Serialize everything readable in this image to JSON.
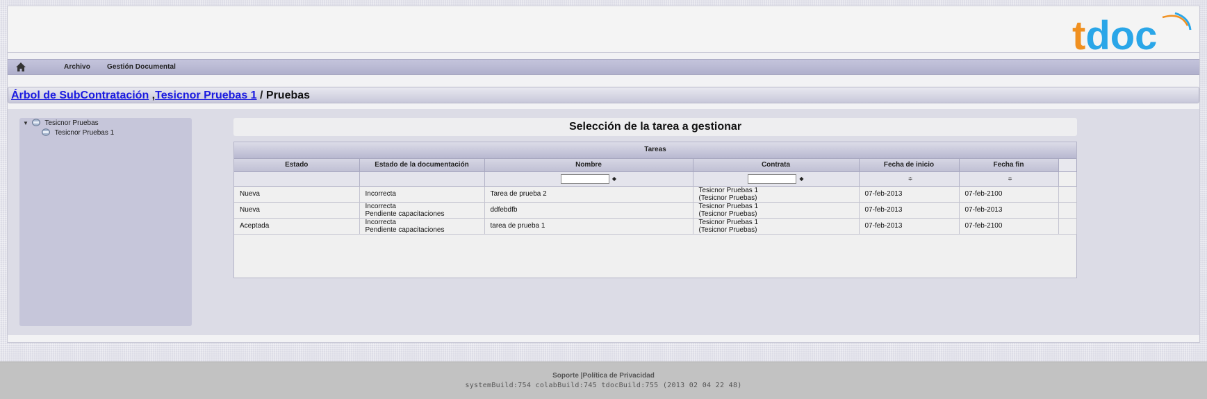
{
  "logo": {
    "text": "tdoc"
  },
  "menu": {
    "home_icon": "home-icon",
    "items": [
      "Archivo",
      "Gestión Documental"
    ]
  },
  "breadcrumb": {
    "link1": "Árbol de SubContratación",
    "sep1": " ,",
    "link2": "Tesicnor Pruebas 1",
    "sep2": " / ",
    "current": "Pruebas"
  },
  "tree": {
    "root": {
      "toggle": "▼",
      "label": "Tesicnor Pruebas"
    },
    "child": {
      "label": "Tesicnor Pruebas 1"
    }
  },
  "main": {
    "title": "Selección de la tarea a gestionar"
  },
  "grid": {
    "caption": "Tareas",
    "columns": [
      "Estado",
      "Estado de la documentación",
      "Nombre",
      "Contrata",
      "Fecha de inicio",
      "Fecha fin"
    ],
    "filter_ops": {
      "nombre": "◆",
      "contrata": "◆",
      "inicio": "≑",
      "fin": "≑"
    },
    "rows": [
      {
        "estado": "Nueva",
        "doc1": "Incorrecta",
        "doc2": "",
        "nombre": "Tarea de prueba 2",
        "contrata1": "Tesicnor Pruebas 1",
        "contrata2": "(Tesicnor Pruebas)",
        "inicio": "07-feb-2013",
        "fin": "07-feb-2100"
      },
      {
        "estado": "Nueva",
        "doc1": "Incorrecta",
        "doc2": "Pendiente capacitaciones",
        "nombre": "ddfebdfb",
        "contrata1": "Tesicnor Pruebas 1",
        "contrata2": "(Tesicnor Pruebas)",
        "inicio": "07-feb-2013",
        "fin": "07-feb-2013"
      },
      {
        "estado": "Aceptada",
        "doc1": "Incorrecta",
        "doc2": "Pendiente capacitaciones",
        "nombre": "tarea de prueba 1",
        "contrata1": "Tesicnor Pruebas 1",
        "contrata2": "(Tesicnor Pruebas)",
        "inicio": "07-feb-2013",
        "fin": "07-feb-2100"
      }
    ]
  },
  "footer": {
    "soporte": "Soporte",
    "separator": " |",
    "privacidad": "Política de Privacidad",
    "build": "systemBuild:754   colabBuild:745   tdocBuild:755 (2013 02 04 22 48)"
  },
  "colors": {
    "estado_text": "#0a8a0a",
    "doc_text": "#e01010",
    "link": "#1a1ae0",
    "logo_orange": "#f09020",
    "logo_blue": "#2aa6e8"
  }
}
